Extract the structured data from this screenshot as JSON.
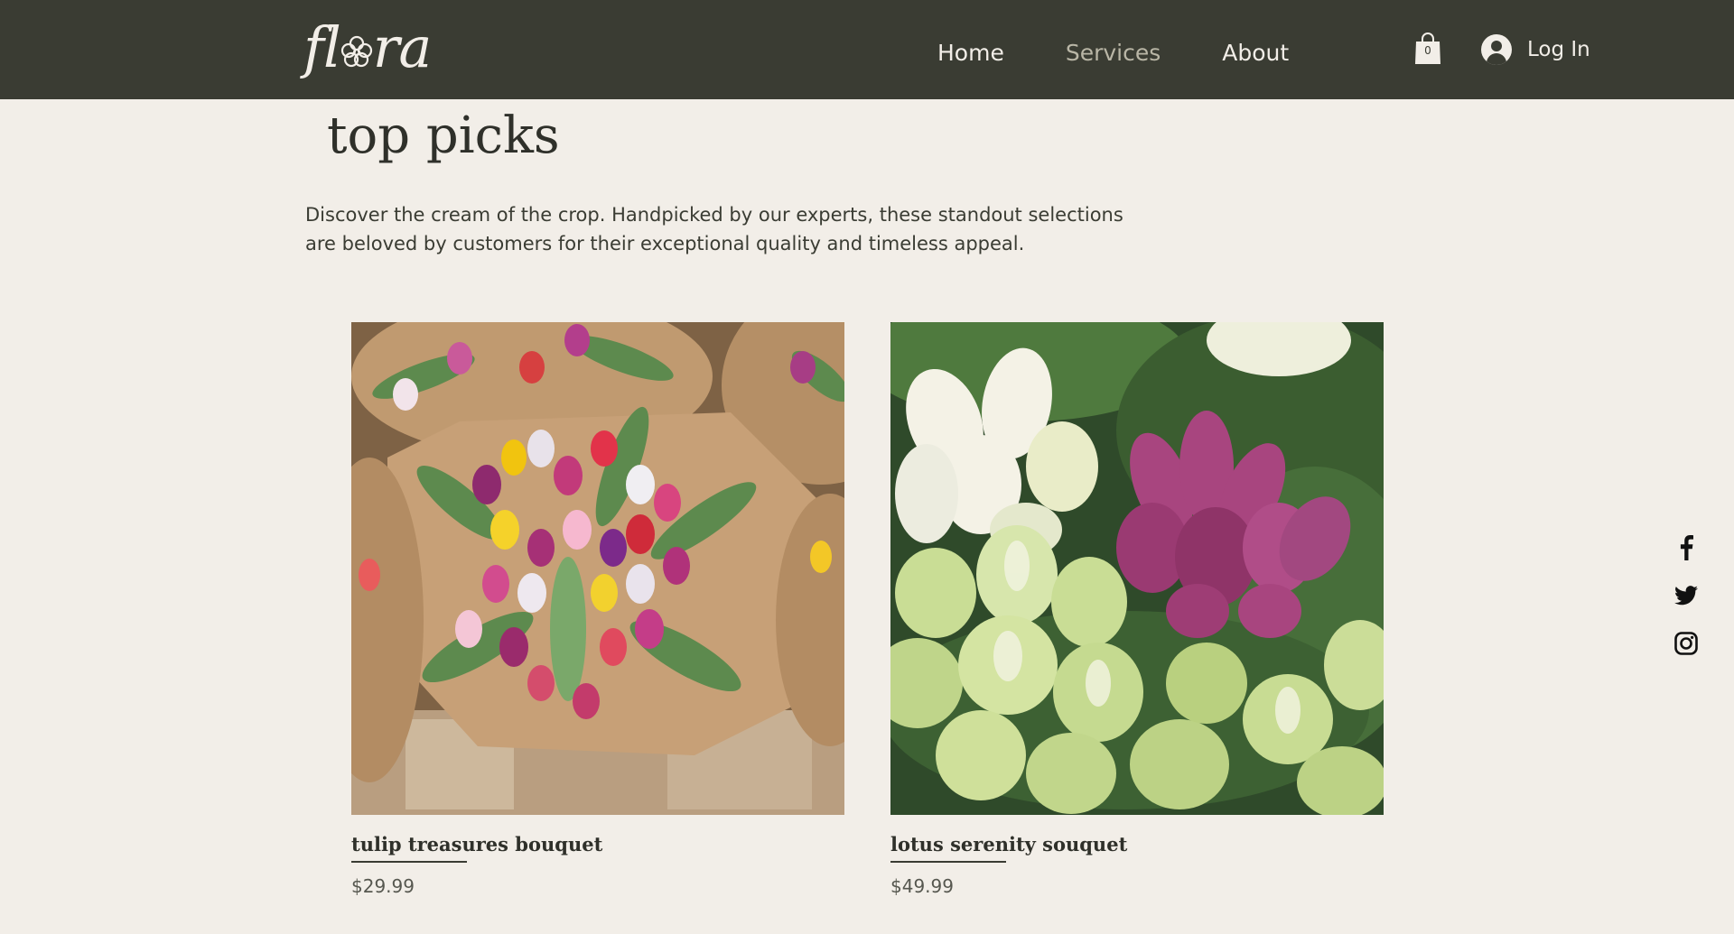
{
  "header": {
    "logo": "flora",
    "nav": [
      {
        "label": "Home"
      },
      {
        "label": "Services"
      },
      {
        "label": "About"
      }
    ],
    "cart_count": "0",
    "login_label": "Log In"
  },
  "main": {
    "title": "top picks",
    "description_line1": "Discover the cream of the crop. Handpicked by our experts, these standout selections",
    "description_line2": "are beloved by customers for their exceptional quality and timeless appeal.",
    "products": [
      {
        "name": "tulip treasures bouquet",
        "price": "$29.99"
      },
      {
        "name": "lotus serenity souquet",
        "price": "$49.99"
      }
    ]
  },
  "social": {
    "icons": [
      "facebook-icon",
      "twitter-icon",
      "instagram-icon"
    ]
  },
  "colors": {
    "header_bg": "#3a3c33",
    "page_bg": "#f2eee8",
    "text_dark": "#2f302a",
    "nav_muted": "#b9b6a6"
  }
}
